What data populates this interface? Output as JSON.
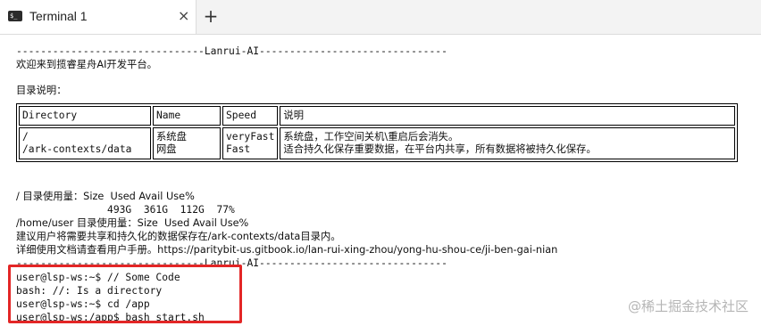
{
  "tab": {
    "title": "Terminal 1",
    "close_glyph": "×",
    "new_tab_glyph": "+",
    "icon_text": "$_"
  },
  "terminal": {
    "banner": "-------------------------------Lanrui-AI-------------------------------",
    "welcome": "欢迎来到揽睿星舟AI开发平台。",
    "dir_heading": "目录说明：",
    "table": {
      "headers": [
        "Directory",
        "Name",
        "Speed",
        "说明"
      ],
      "rows": [
        {
          "dir": "/",
          "name": "系统盘",
          "speed": "veryFast",
          "desc": "系统盘，工作空间关机\\重启后会消失。"
        },
        {
          "dir": "/ark-contexts/data",
          "name": "网盘",
          "speed": "Fast",
          "desc": "适合持久化保存重要数据，在平台内共享，所有数据将被持久化保存。"
        }
      ]
    },
    "usage_root_label": "/ 目录使用量：Size  Used Avail Use%",
    "usage_root_values": "               493G  361G  112G  77%",
    "usage_home_label": "/home/user 目录使用量：Size  Used Avail Use%",
    "advice": "建议用户将需要共享和持久化的数据保存在/ark-contexts/data目录内。",
    "doc_link": "详细使用文档请查看用户手册。https://paritybit-us.gitbook.io/lan-rui-xing-zhou/yong-hu-shou-ce/ji-ben-gai-nian",
    "banner_end": "-------------------------------Lanrui-AI-------------------------------",
    "commands": [
      "user@lsp-ws:~$ // Some Code",
      "bash: //: Is a directory",
      "user@lsp-ws:~$ cd /app",
      "user@lsp-ws:/app$ bash start.sh"
    ]
  },
  "watermark": "@稀土掘金技术社区",
  "colors": {
    "highlight": "#e32626",
    "background": "#ffffff",
    "text": "#111111"
  }
}
